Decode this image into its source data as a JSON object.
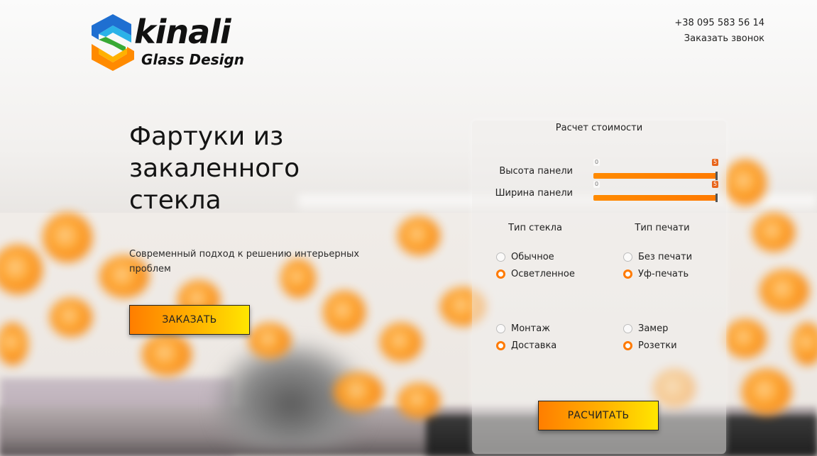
{
  "header": {
    "logo_word": "kinali",
    "logo_sub": "Glass Design",
    "phone": "+38 095 583 56 14",
    "callback": "Заказать звонок"
  },
  "hero": {
    "title_lines": [
      "Фартуки из",
      "закаленного",
      "стекла"
    ],
    "subtitle": "Современный подход к решению интерьерных проблем",
    "order_button": "ЗАКАЗАТЬ"
  },
  "calculator": {
    "title": "Расчет стоимости",
    "sliders": [
      {
        "label": "Высота панели",
        "min": "0",
        "max": "5",
        "value": 5
      },
      {
        "label": "Ширина панели",
        "min": "0",
        "max": "5",
        "value": 5
      }
    ],
    "glass_type": {
      "title": "Тип стекла",
      "options": [
        {
          "label": "Обычное",
          "checked": false
        },
        {
          "label": "Осветленное",
          "checked": true
        }
      ]
    },
    "print_type": {
      "title": "Тип печати",
      "options": [
        {
          "label": "Без печати",
          "checked": false
        },
        {
          "label": "Уф-печать",
          "checked": true
        }
      ]
    },
    "extras_left": [
      {
        "label": "Монтаж",
        "checked": false
      },
      {
        "label": "Доставка",
        "checked": true
      }
    ],
    "extras_right": [
      {
        "label": "Замер",
        "checked": false
      },
      {
        "label": "Розетки",
        "checked": true
      }
    ],
    "calc_button": "РАСЧИТАТЬ"
  },
  "colors": {
    "accent": "#ff7a00",
    "button_gradient_end": "#ffe600"
  }
}
